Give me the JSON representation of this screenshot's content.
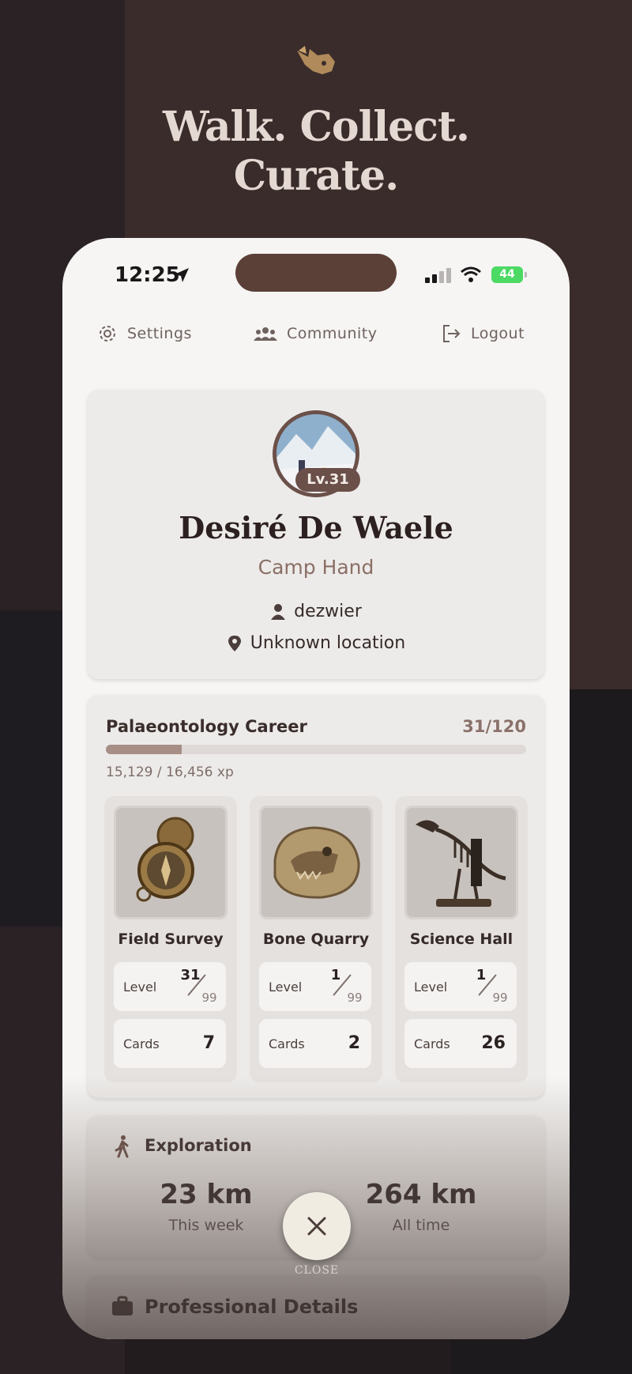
{
  "hero": {
    "title_line1": "Walk. Collect.",
    "title_line2": "Curate.",
    "icon": "triceratops-skull-icon"
  },
  "status_bar": {
    "time": "12:25",
    "battery": "44"
  },
  "top_nav": {
    "settings": "Settings",
    "community": "Community",
    "logout": "Logout"
  },
  "profile": {
    "level_badge": "Lv.31",
    "name": "Desiré De Waele",
    "rank": "Camp Hand",
    "username": "dezwier",
    "location": "Unknown location"
  },
  "career": {
    "title": "Palaeontology Career",
    "count": "31/120",
    "xp_text": "15,129 / 16,456 xp",
    "progress_fraction": 0.18,
    "tiles": [
      {
        "name": "Field Survey",
        "level_label": "Level",
        "level": "31",
        "level_max": "99",
        "cards_label": "Cards",
        "cards": "7",
        "icon": "compass-icon"
      },
      {
        "name": "Bone Quarry",
        "level_label": "Level",
        "level": "1",
        "level_max": "99",
        "cards_label": "Cards",
        "cards": "2",
        "icon": "fossil-skull-icon"
      },
      {
        "name": "Science Hall",
        "level_label": "Level",
        "level": "1",
        "level_max": "99",
        "cards_label": "Cards",
        "cards": "26",
        "icon": "dinosaur-skeleton-icon"
      }
    ]
  },
  "exploration": {
    "title": "Exploration",
    "week_value": "23 km",
    "week_label": "This week",
    "total_value": "264 km",
    "total_label": "All time"
  },
  "professional": {
    "title": "Professional Details"
  },
  "close": {
    "label": "CLOSE"
  },
  "colors": {
    "accent_brown": "#6b5049",
    "island": "#5b4038",
    "battery_green": "#4cd964"
  }
}
